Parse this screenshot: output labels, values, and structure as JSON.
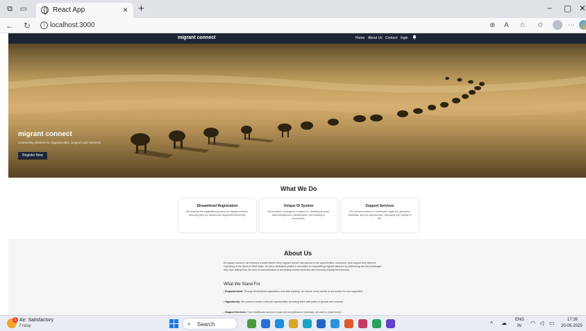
{
  "browser": {
    "tab_title": "React App",
    "tab_close": "×",
    "new_tab": "+",
    "url": "localhost:3000",
    "window_controls": [
      "−",
      "▢",
      "✕"
    ],
    "nav_icons": [
      "back-icon",
      "reload-icon"
    ],
    "toolbar_icons": [
      "zoom-icon",
      "read-aloud-icon",
      "favorite-icon",
      "collections-icon",
      "profile-icon",
      "more-icon",
      "copilot-icon"
    ]
  },
  "site": {
    "brand": "migrant connect",
    "nav": [
      "Home",
      "About Us",
      "Contact",
      "login"
    ],
    "hero": {
      "title": "migrant connect",
      "subtitle": "Connecting Workers to Opportunities, Support and Services",
      "button": "Register Now"
    },
    "what_we_do": {
      "title": "What We Do",
      "cards": [
        {
          "title": "Streamlined Registration",
          "text": "We simplify the registration process for migrant workers, ensuring they are tracked and supported effectively."
        },
        {
          "title": "Unique ID System",
          "text": "Each worker is assigned a unique ID, enabling accurate data management, identification, and tracking of movements."
        },
        {
          "title": "Support Services",
          "text": "We connect workers to healthcare, legal aid, grievance redressal, and job opportunities, improving their quality of life."
        }
      ]
    },
    "about": {
      "title": "About Us",
      "text": "At migrant connect, we envision a world where every migrant worker has access to the opportunities, resources, and support they deserve. Operating at the heart of Tamil Nadu, we are a dedicated platform committed to empowering migrant laborers by addressing the key challenges they face arising from the lack of documentation to accessing welfare schemes and ensuring employment security.",
      "stand_title": "What We Stand For",
      "bullets": [
        {
          "label": "Empowerment:",
          "text": " Through streamlined registration and data tracking, we ensure every worker is accounted for and supported."
        },
        {
          "label": "Opportunity:",
          "text": " We connect workers with job opportunities, providing them with paths to growth and success."
        },
        {
          "label": "Support Services:",
          "text": " From healthcare access to legal aid and grievance redressal, we work to make every..."
        }
      ]
    }
  },
  "taskbar": {
    "weather_badge": "1",
    "weather_main": "Air: Satisfactory",
    "weather_sub": "Friday",
    "search": "Search",
    "lang_top": "ENG",
    "lang_bottom": "IN",
    "time": "17:39",
    "date": "20-05-2025",
    "app_colors": [
      "#4a9b3c",
      "#2b6fd6",
      "#1f8fe0",
      "#d9a52b",
      "#1aa3c8",
      "#2366c9",
      "#2f8fe0",
      "#e0592a",
      "#c73a64",
      "#27a35a",
      "#5e43c9"
    ]
  }
}
